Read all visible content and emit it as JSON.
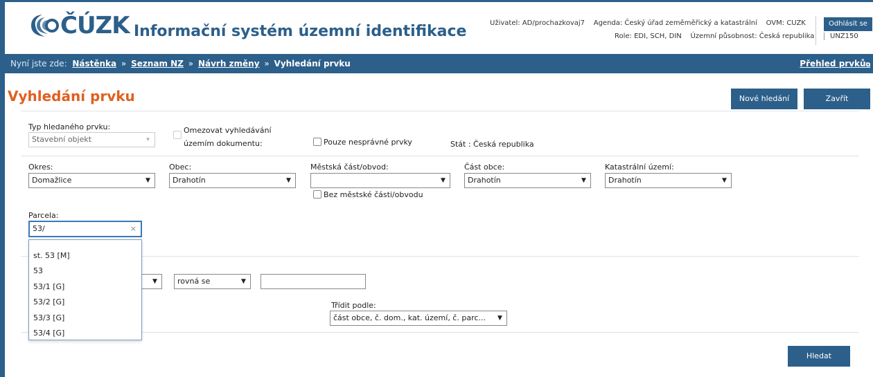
{
  "header": {
    "logo_text": "ČÚZK",
    "app_title": "Informační systém územní identifikace",
    "user": "Uživatel: AD/prochazkovaj7",
    "agenda": "Agenda: Český úřad zeměměřický a katastrální",
    "ovm": "OVM: CUZK",
    "role": "Role: EDI, SCH, DIN",
    "territory": "Územní působnost: Česká republika",
    "logout": "Odhlásit se",
    "unz": "UNZ150"
  },
  "breadcrumb": {
    "label": "Nyní jste zde:",
    "items": [
      "Nástěnka",
      "Seznam NZ",
      "Návrh změny"
    ],
    "separator": "»",
    "current": "Vyhledání prvku",
    "overview_link": "Přehled prvků"
  },
  "page": {
    "title": "Vyhledání prvku",
    "new_search": "Nové hledání",
    "close": "Zavřít",
    "search": "Hledat"
  },
  "form": {
    "type_label": "Typ hledaného prvku:",
    "type_value": "Stavební objekt",
    "restrict_label_1": "Omezovat vyhledávání",
    "restrict_label_2": "územím dokumentu:",
    "only_incorrect": "Pouze nesprávné prvky",
    "state": "Stát : Česká republika",
    "okres_label": "Okres:",
    "okres_value": "Domažlice",
    "obec_label": "Obec:",
    "obec_value": "Drahotín",
    "mestska_cast_label": "Městská část/obvod:",
    "mestska_cast_value": "",
    "bez_mestske_casti": "Bez městské části/obvodu",
    "cast_obce_label": "Část obce:",
    "cast_obce_value": "Drahotín",
    "kat_uzemi_label": "Katastrální území:",
    "kat_uzemi_value": "Drahotín",
    "parcela_label": "Parcela:",
    "parcela_value": "53/",
    "parcela_clear": "×",
    "parcela_options": [
      "st. 53 [M]",
      "53",
      "53/1 [G]",
      "53/2 [G]",
      "53/3 [G]",
      "53/4 [G]"
    ],
    "operator_value": "rovná se",
    "filter_value": "",
    "sort_label": "Třídit podle:",
    "sort_value": "část obce, č. dom., kat. území, č. parc..."
  },
  "colors": {
    "primary": "#2c5f8a",
    "title_orange": "#e06020"
  }
}
